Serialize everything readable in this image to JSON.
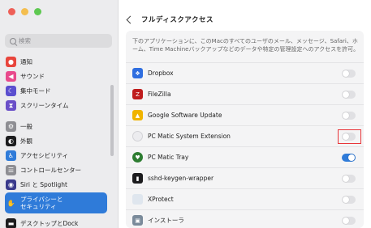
{
  "window": {
    "title": "フルディスクアクセス"
  },
  "sidebar": {
    "search_placeholder": "検索",
    "items": [
      {
        "label": "通知",
        "icon": "bell-icon",
        "color": "#e8453c"
      },
      {
        "label": "サウンド",
        "icon": "speaker-icon",
        "color": "#e84a8c"
      },
      {
        "label": "集中モード",
        "icon": "moon-icon",
        "color": "#5b4fcf"
      },
      {
        "label": "スクリーンタイム",
        "icon": "hourglass-icon",
        "color": "#6a4fc8"
      },
      {
        "label": "一般",
        "icon": "gear-icon",
        "color": "#8e8e93"
      },
      {
        "label": "外観",
        "icon": "appearance-icon",
        "color": "#1c1c1e"
      },
      {
        "label": "アクセシビリティ",
        "icon": "accessibility-icon",
        "color": "#2f7bd9"
      },
      {
        "label": "コントロールセンター",
        "icon": "control-center-icon",
        "color": "#8e8e93"
      },
      {
        "label": "Siri と Spotlight",
        "icon": "siri-icon",
        "color": "#3a3a8c"
      },
      {
        "label": "プライバシーと\nセキュリティ",
        "icon": "hand-icon",
        "color": "#2f7bd9"
      },
      {
        "label": "デスクトップとDock",
        "icon": "dock-icon",
        "color": "#1c1c1e"
      }
    ]
  },
  "main": {
    "description": "下のアプリケーションに、このMacのすべてのユーザのメール、メッセージ、Safari、ホーム、Time Machineバックアップなどのデータや特定の管理設定へのアクセスを許可。",
    "apps": [
      {
        "name": "Dropbox",
        "icon": "dropbox-icon",
        "color": "#2f6ee0",
        "enabled": false
      },
      {
        "name": "FileZilla",
        "icon": "filezilla-icon",
        "color": "#bf1d1d",
        "enabled": false
      },
      {
        "name": "Google Software Update",
        "icon": "google-update-icon",
        "color": "#f0b400",
        "enabled": false
      },
      {
        "name": "PC Matic System Extension",
        "icon": "extension-icon",
        "color": "#d8d8dc",
        "enabled": false,
        "highlighted": true
      },
      {
        "name": "PC Matic Tray",
        "icon": "pcmatic-tray-icon",
        "color": "#2e7d32",
        "enabled": true
      },
      {
        "name": "sshd-keygen-wrapper",
        "icon": "terminal-icon",
        "color": "#1c1c1e",
        "enabled": false
      },
      {
        "name": "XProtect",
        "icon": "xprotect-icon",
        "color": "#dfe6ee",
        "enabled": false
      },
      {
        "name": "インストーラ",
        "icon": "installer-icon",
        "color": "#7a8a9a",
        "enabled": false
      }
    ]
  },
  "colors": {
    "accent": "#2f7bd9",
    "highlight": "#e8363a"
  }
}
